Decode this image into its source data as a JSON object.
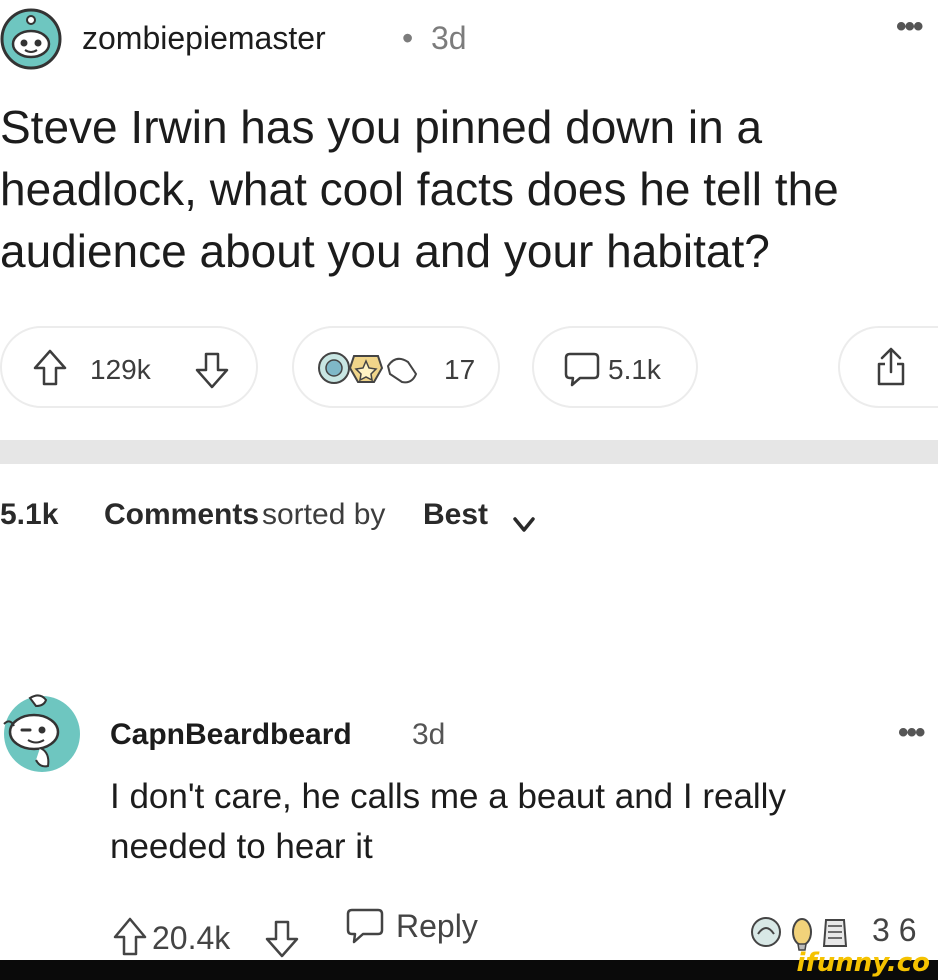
{
  "post": {
    "username": "zombiepiemaster",
    "separator": "•",
    "age": "3d",
    "more": "•••",
    "title": "Steve Irwin has you pinned down in a headlock, what cool facts does he tell the audience about you and your habitat?",
    "votes": "129k",
    "award_count": "17",
    "comments": "5.1k"
  },
  "sort": {
    "count": "5.1k",
    "label": "Comments",
    "by": "sorted by",
    "value": "Best"
  },
  "comment": {
    "username": "CapnBeardbeard",
    "age": "3d",
    "more": "•••",
    "body": "I don't care, he calls me a beaut and I really needed to hear it",
    "votes": "20.4k",
    "reply_label": "Reply",
    "award_count": "3 6"
  },
  "watermark": "ifunny.co",
  "colors": {
    "text": "#1c1c1c",
    "muted": "#7c7c7c",
    "divider": "#e6e6e6",
    "avatar_teal": "#6ec6c0",
    "watermark": "#f5c200"
  },
  "icons": [
    "snoo-avatar-icon",
    "more-icon",
    "upvote-icon",
    "downvote-icon",
    "award-icons",
    "comment-icon",
    "share-icon",
    "chevron-down-icon",
    "reply-icon"
  ]
}
